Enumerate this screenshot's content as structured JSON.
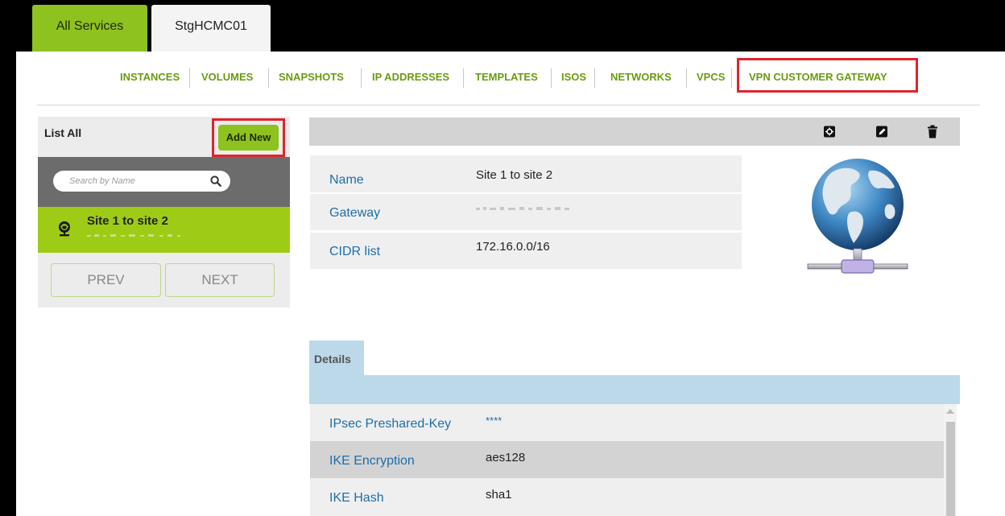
{
  "top_tabs": [
    {
      "label": "All Services",
      "active": true
    },
    {
      "label": "StgHCMC01",
      "active": false
    }
  ],
  "nav": {
    "items": [
      "INSTANCES",
      "VOLUMES",
      "SNAPSHOTS",
      "IP ADDRESSES",
      "TEMPLATES",
      "ISOS",
      "NETWORKS",
      "VPCS",
      "VPN CUSTOMER GATEWAY"
    ],
    "highlighted": "VPN CUSTOMER GATEWAY"
  },
  "sidebar": {
    "list_all_label": "List All",
    "add_new_label": "Add New",
    "search_placeholder": "Search by Name",
    "items": [
      {
        "name": "Site 1 to site 2",
        "icon": "vpn-gateway-icon"
      }
    ],
    "prev_label": "PREV",
    "next_label": "NEXT"
  },
  "toolbar": {
    "icons": [
      "settings-icon",
      "edit-icon",
      "delete-icon"
    ]
  },
  "detail": {
    "rows": [
      {
        "label": "Name",
        "value": "Site 1 to site 2"
      },
      {
        "label": "Gateway",
        "value": ""
      },
      {
        "label": "CIDR list",
        "value": "172.16.0.0/16"
      }
    ],
    "image": "network-globe-icon"
  },
  "details_tab": {
    "label": "Details",
    "rows": [
      {
        "label": "IPsec Preshared-Key",
        "value": "****"
      },
      {
        "label": "IKE Encryption",
        "value": "aes128"
      },
      {
        "label": "IKE Hash",
        "value": "sha1"
      }
    ]
  },
  "colors": {
    "accent_green": "#8dc21f",
    "selected_green": "#9ecb16",
    "nav_green": "#6a9a12",
    "label_blue": "#1f6ea8",
    "highlight_red": "#e0242c",
    "details_blue": "#bcd9ea"
  }
}
